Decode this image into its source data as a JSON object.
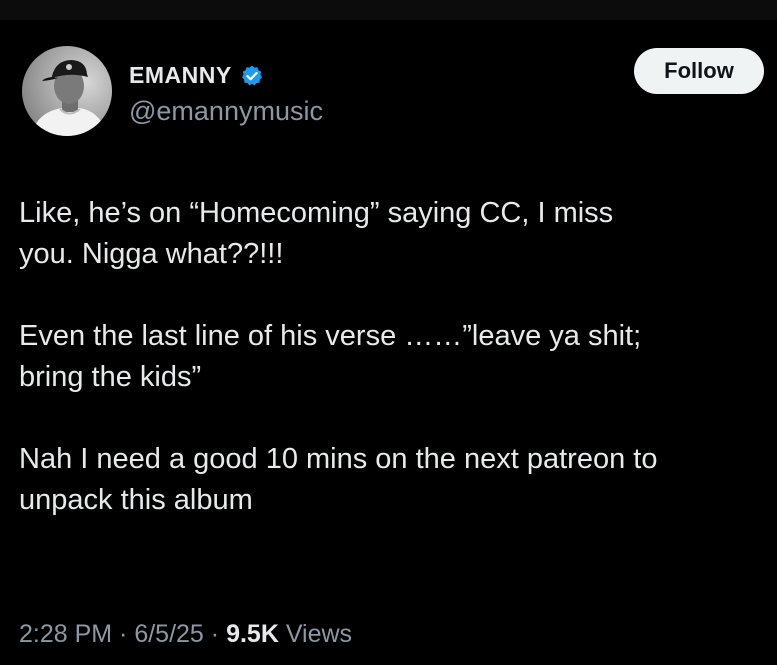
{
  "colors": {
    "background": "#000000",
    "primary_text": "#e7e9ea",
    "secondary_text": "#8b98a5",
    "verified_badge": "#1d9bf0",
    "follow_button_bg": "#eff3f4"
  },
  "author": {
    "display_name": "EMANNY",
    "verified": true,
    "handle": "@emannymusic",
    "avatar_icon": "profile-photo"
  },
  "actions": {
    "follow_label": "Follow"
  },
  "tweet": {
    "paragraphs": [
      "Like, he’s on “Homecoming” saying CC, I miss\nyou. Nigga what??!!!",
      "Even the last line of his verse ……”leave ya shit;\nbring the kids”",
      "Nah I need a good 10 mins on the next patreon to\nunpack this album"
    ]
  },
  "meta": {
    "time": "2:28 PM",
    "separator": " · ",
    "date": "6/5/25",
    "views_count": "9.5K",
    "views_label": " Views"
  }
}
